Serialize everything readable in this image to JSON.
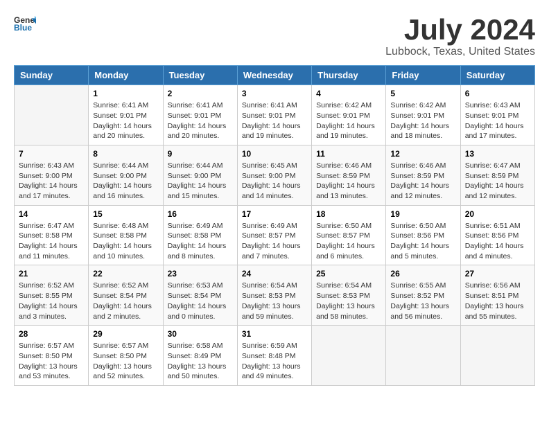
{
  "header": {
    "logo_general": "General",
    "logo_blue": "Blue",
    "title": "July 2024",
    "subtitle": "Lubbock, Texas, United States"
  },
  "weekdays": [
    "Sunday",
    "Monday",
    "Tuesday",
    "Wednesday",
    "Thursday",
    "Friday",
    "Saturday"
  ],
  "weeks": [
    [
      {
        "day": "",
        "content": ""
      },
      {
        "day": "1",
        "content": "Sunrise: 6:41 AM\nSunset: 9:01 PM\nDaylight: 14 hours\nand 20 minutes."
      },
      {
        "day": "2",
        "content": "Sunrise: 6:41 AM\nSunset: 9:01 PM\nDaylight: 14 hours\nand 20 minutes."
      },
      {
        "day": "3",
        "content": "Sunrise: 6:41 AM\nSunset: 9:01 PM\nDaylight: 14 hours\nand 19 minutes."
      },
      {
        "day": "4",
        "content": "Sunrise: 6:42 AM\nSunset: 9:01 PM\nDaylight: 14 hours\nand 19 minutes."
      },
      {
        "day": "5",
        "content": "Sunrise: 6:42 AM\nSunset: 9:01 PM\nDaylight: 14 hours\nand 18 minutes."
      },
      {
        "day": "6",
        "content": "Sunrise: 6:43 AM\nSunset: 9:01 PM\nDaylight: 14 hours\nand 17 minutes."
      }
    ],
    [
      {
        "day": "7",
        "content": "Sunrise: 6:43 AM\nSunset: 9:00 PM\nDaylight: 14 hours\nand 17 minutes."
      },
      {
        "day": "8",
        "content": "Sunrise: 6:44 AM\nSunset: 9:00 PM\nDaylight: 14 hours\nand 16 minutes."
      },
      {
        "day": "9",
        "content": "Sunrise: 6:44 AM\nSunset: 9:00 PM\nDaylight: 14 hours\nand 15 minutes."
      },
      {
        "day": "10",
        "content": "Sunrise: 6:45 AM\nSunset: 9:00 PM\nDaylight: 14 hours\nand 14 minutes."
      },
      {
        "day": "11",
        "content": "Sunrise: 6:46 AM\nSunset: 8:59 PM\nDaylight: 14 hours\nand 13 minutes."
      },
      {
        "day": "12",
        "content": "Sunrise: 6:46 AM\nSunset: 8:59 PM\nDaylight: 14 hours\nand 12 minutes."
      },
      {
        "day": "13",
        "content": "Sunrise: 6:47 AM\nSunset: 8:59 PM\nDaylight: 14 hours\nand 12 minutes."
      }
    ],
    [
      {
        "day": "14",
        "content": "Sunrise: 6:47 AM\nSunset: 8:58 PM\nDaylight: 14 hours\nand 11 minutes."
      },
      {
        "day": "15",
        "content": "Sunrise: 6:48 AM\nSunset: 8:58 PM\nDaylight: 14 hours\nand 10 minutes."
      },
      {
        "day": "16",
        "content": "Sunrise: 6:49 AM\nSunset: 8:58 PM\nDaylight: 14 hours\nand 8 minutes."
      },
      {
        "day": "17",
        "content": "Sunrise: 6:49 AM\nSunset: 8:57 PM\nDaylight: 14 hours\nand 7 minutes."
      },
      {
        "day": "18",
        "content": "Sunrise: 6:50 AM\nSunset: 8:57 PM\nDaylight: 14 hours\nand 6 minutes."
      },
      {
        "day": "19",
        "content": "Sunrise: 6:50 AM\nSunset: 8:56 PM\nDaylight: 14 hours\nand 5 minutes."
      },
      {
        "day": "20",
        "content": "Sunrise: 6:51 AM\nSunset: 8:56 PM\nDaylight: 14 hours\nand 4 minutes."
      }
    ],
    [
      {
        "day": "21",
        "content": "Sunrise: 6:52 AM\nSunset: 8:55 PM\nDaylight: 14 hours\nand 3 minutes."
      },
      {
        "day": "22",
        "content": "Sunrise: 6:52 AM\nSunset: 8:54 PM\nDaylight: 14 hours\nand 2 minutes."
      },
      {
        "day": "23",
        "content": "Sunrise: 6:53 AM\nSunset: 8:54 PM\nDaylight: 14 hours\nand 0 minutes."
      },
      {
        "day": "24",
        "content": "Sunrise: 6:54 AM\nSunset: 8:53 PM\nDaylight: 13 hours\nand 59 minutes."
      },
      {
        "day": "25",
        "content": "Sunrise: 6:54 AM\nSunset: 8:53 PM\nDaylight: 13 hours\nand 58 minutes."
      },
      {
        "day": "26",
        "content": "Sunrise: 6:55 AM\nSunset: 8:52 PM\nDaylight: 13 hours\nand 56 minutes."
      },
      {
        "day": "27",
        "content": "Sunrise: 6:56 AM\nSunset: 8:51 PM\nDaylight: 13 hours\nand 55 minutes."
      }
    ],
    [
      {
        "day": "28",
        "content": "Sunrise: 6:57 AM\nSunset: 8:50 PM\nDaylight: 13 hours\nand 53 minutes."
      },
      {
        "day": "29",
        "content": "Sunrise: 6:57 AM\nSunset: 8:50 PM\nDaylight: 13 hours\nand 52 minutes."
      },
      {
        "day": "30",
        "content": "Sunrise: 6:58 AM\nSunset: 8:49 PM\nDaylight: 13 hours\nand 50 minutes."
      },
      {
        "day": "31",
        "content": "Sunrise: 6:59 AM\nSunset: 8:48 PM\nDaylight: 13 hours\nand 49 minutes."
      },
      {
        "day": "",
        "content": ""
      },
      {
        "day": "",
        "content": ""
      },
      {
        "day": "",
        "content": ""
      }
    ]
  ]
}
